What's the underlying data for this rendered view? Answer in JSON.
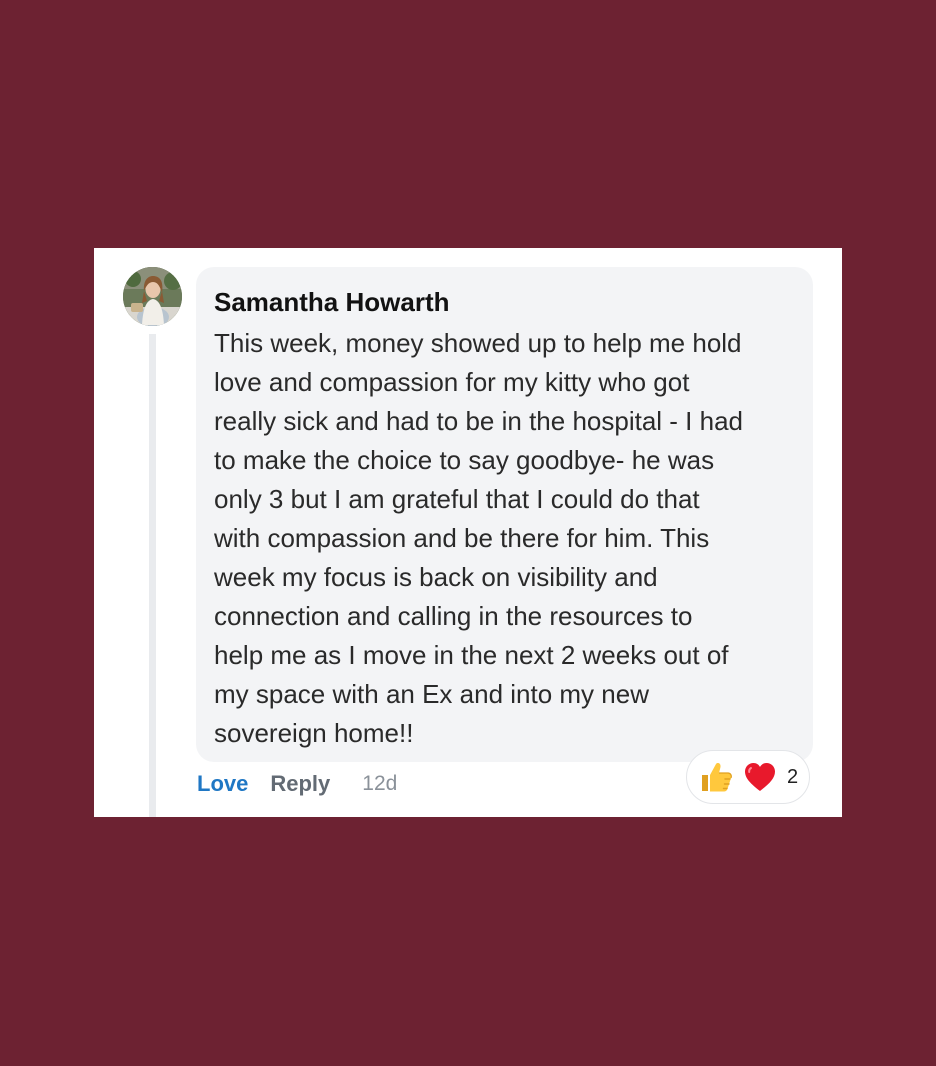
{
  "comment": {
    "author": "Samantha Howarth",
    "text": "This week, money showed up to help me hold\nlove and compassion for my kitty who got\nreally sick and had to be in the hospital - I had\nto make the choice to say goodbye- he was\nonly 3 but I am grateful that I could do that\nwith compassion and be there for him. This\nweek my focus is back on visibility and\nconnection and calling in the resources to\nhelp me as I move in the next 2 weeks out of\nmy space with an Ex and into my new\nsovereign home!!",
    "timestamp": "12d"
  },
  "actions": {
    "love_label": "Love",
    "reply_label": "Reply"
  },
  "reactions": {
    "icons": [
      "thumbs-up-icon",
      "heart-icon"
    ],
    "count": "2"
  },
  "colors": {
    "background": "#6d2232",
    "card": "#ffffff",
    "bubble": "#f3f4f6",
    "love_link": "#1f77c4",
    "reply_link": "#636b74"
  }
}
